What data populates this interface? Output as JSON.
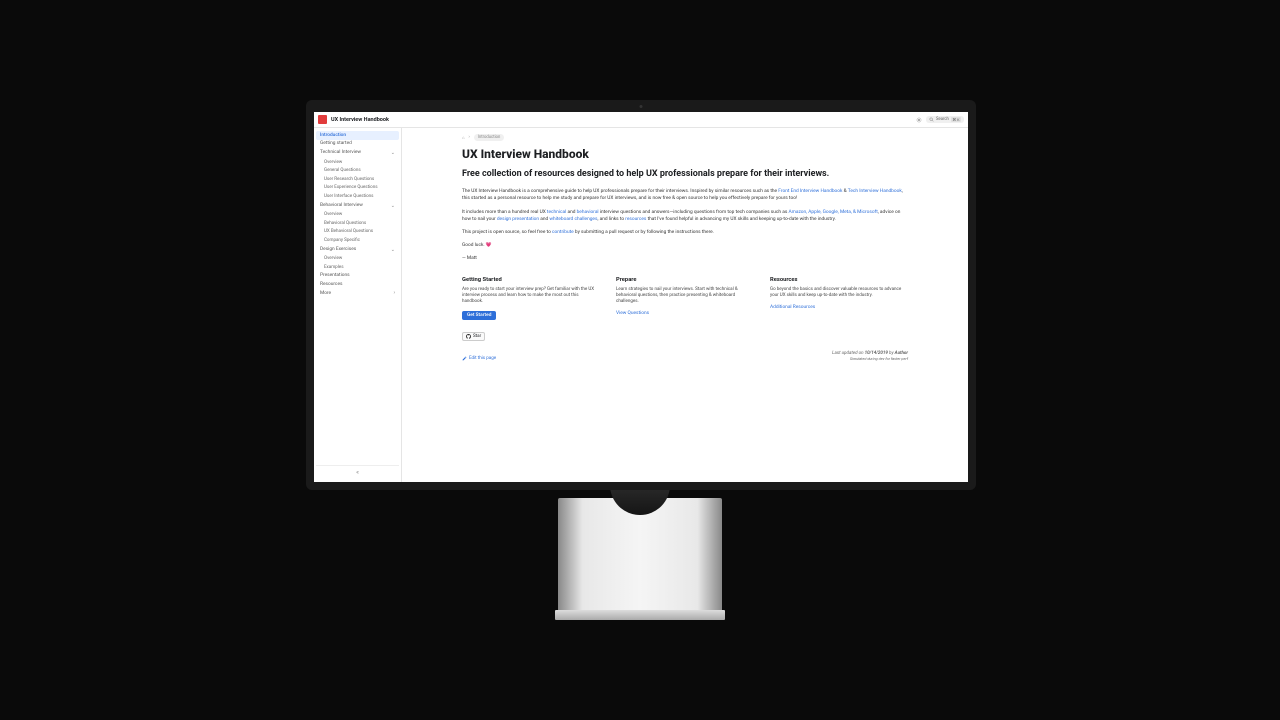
{
  "header": {
    "brand": "UX Interview Handbook",
    "search_placeholder": "Search",
    "search_kbd": "⌘ K"
  },
  "sidebar": {
    "items": [
      {
        "label": "Introduction",
        "active": true
      },
      {
        "label": "Getting started"
      },
      {
        "label": "Technical Interview",
        "expandable": true,
        "children": [
          "Overview",
          "General Questions",
          "User Research Questions",
          "User Experience Questions",
          "User Interface Questions"
        ]
      },
      {
        "label": "Behavioral Interview",
        "expandable": true,
        "children": [
          "Overview",
          "Behavioral Questions",
          "UX Behavioral Questions",
          "Company Specific"
        ]
      },
      {
        "label": "Design Exercises",
        "expandable": true,
        "children": [
          "Overview",
          "Examples"
        ]
      },
      {
        "label": "Presentations"
      },
      {
        "label": "Resources"
      },
      {
        "label": "More",
        "expandable": true,
        "collapsed": true
      }
    ],
    "collapse_label": "«"
  },
  "breadcrumb": {
    "home_icon": "⌂",
    "sep": "›",
    "current": "Introduction"
  },
  "content": {
    "h1": "UX Interview Handbook",
    "tagline": "Free collection of resources designed to help UX professionals prepare for their interviews.",
    "p1_a": "The UX Interview Handbook is a comprehensive guide to help UX professionals prepare for their interviews. Inspired by similar resources such as the ",
    "p1_link1": "Front End Interview Handbook",
    "p1_amp": " & ",
    "p1_link2": "Tech Interview Handbook",
    "p1_b": ", this started as a personal resource to help me study and prepare for UX interviews, and is now free & open source to help you effectively prepare for yours too!",
    "p2_a": "It includes more than a hundred real UX ",
    "p2_link_technical": "technical",
    "p2_and": " and ",
    "p2_link_behavioral": "behavioral",
    "p2_b": " interview questions and answers—including questions from top tech companies such as ",
    "p2_companies": "Amazon, Apple, Google, Meta, & Microsoft",
    "p2_c": ", advice on how to nail your ",
    "p2_link_design": "design presentation",
    "p2_d": " and ",
    "p2_link_wb": "whiteboard challenges",
    "p2_e": ", and links to ",
    "p2_link_res": "resources",
    "p2_f": " that I've found helpful in advancing my UX skills and keeping up-to-date with the industry.",
    "p3_a": "This project is open source, so feel free to ",
    "p3_link": "contribute",
    "p3_b": " by submitting a pull request or by following the instructions there.",
    "p4": "Good luck. 💗",
    "sig": "— Matt"
  },
  "cards": [
    {
      "title": "Getting Started",
      "body": "Are you ready to start your interview prep? Get familiar with the UX interview process and learn how to make the most out this handbook.",
      "cta": "Get Started",
      "cta_primary": true
    },
    {
      "title": "Prepare",
      "body": "Learn strategies to nail your interviews. Start with technical & behavioral questions, then practice presenting & whiteboard challenges.",
      "cta": "View Questions"
    },
    {
      "title": "Resources",
      "body": "Go beyond the basics and discover valuable resources to advance your UX skills and keep up-to-date with the industry.",
      "cta": "Additional Resources"
    }
  ],
  "github": {
    "star": "Star"
  },
  "footer": {
    "edit": "Edit this page",
    "updated_prefix": "Last updated on ",
    "updated_date": "10/14/2019",
    "updated_by_prefix": " by ",
    "updated_author": "Author",
    "sim_note": "Simulated during dev for faster perf"
  }
}
